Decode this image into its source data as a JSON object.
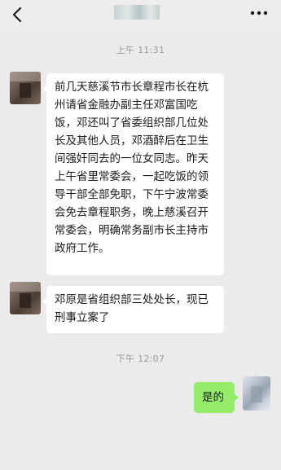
{
  "header": {
    "back_icon": "chevron-left-icon",
    "contact_name": "",
    "more_icon": "more-dots-icon"
  },
  "messages": [
    {
      "timestamp": "上午 11:31",
      "sender": "contact",
      "text": "前几天慈溪节市长章程市长在杭州请省金融办副主任邓富国吃饭，邓还叫了省委组织部几位处长及其他人员，邓酒醉后在卫生间强奸同去的一位女同志。昨天上午省里常委会，一起吃饭的领导干部全部免职，下午宁波常委会免去章程职务，晚上慈溪召开常委会，明确常务副市长主持市政府工作。"
    },
    {
      "sender": "contact",
      "text": "邓原是省组织部三处处长，现已刑事立案了"
    },
    {
      "timestamp": "下午 12:07",
      "sender": "me",
      "text": "是的"
    }
  ],
  "colors": {
    "background": "#ebebeb",
    "incoming_bubble": "#ffffff",
    "outgoing_bubble": "#95ec69",
    "timestamp_text": "#9a9a9a"
  }
}
